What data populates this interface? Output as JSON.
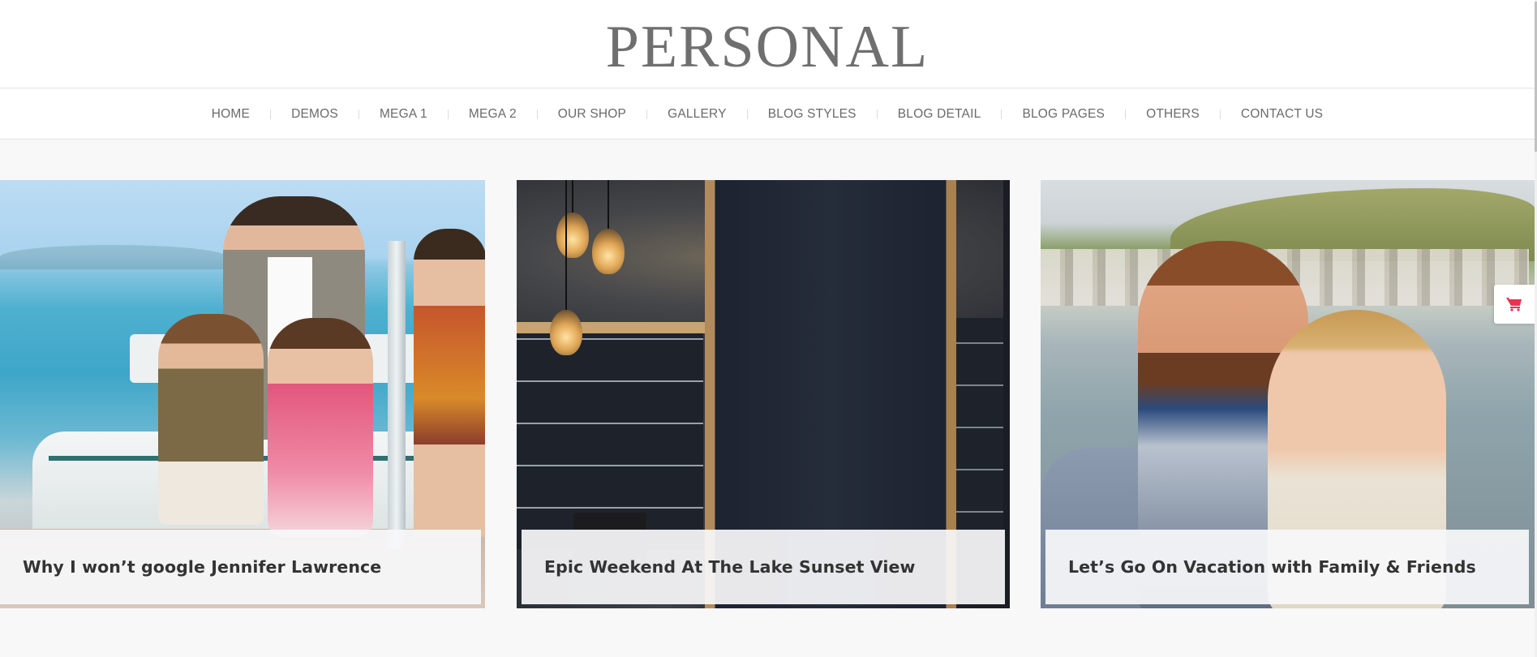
{
  "site": {
    "logo_text": "PERSONAL"
  },
  "nav": {
    "items": [
      {
        "label": "HOME"
      },
      {
        "label": "DEMOS"
      },
      {
        "label": "MEGA 1"
      },
      {
        "label": "MEGA 2"
      },
      {
        "label": "OUR SHOP"
      },
      {
        "label": "GALLERY"
      },
      {
        "label": "BLOG STYLES"
      },
      {
        "label": "BLOG DETAIL"
      },
      {
        "label": "BLOG PAGES"
      },
      {
        "label": "OTHERS"
      },
      {
        "label": "CONTACT US"
      }
    ]
  },
  "slider": {
    "cards": [
      {
        "title": "Why I won’t google Jennifer Lawrence",
        "image": "family-on-pier-photo"
      },
      {
        "title": "Epic Weekend At The Lake Sunset View",
        "image": "chalkboard-kitchen-photo"
      },
      {
        "title": "Let’s Go On Vacation with Family & Friends",
        "image": "couple-selfie-photo"
      }
    ]
  },
  "widgets": {
    "cart_icon": "shopping-cart-icon",
    "cart_color": "#e8334f"
  },
  "colors": {
    "logo": "#6f6f6f",
    "nav_text": "#6a6a6a",
    "page_bg": "#f8f8f8",
    "caption_text": "#333333"
  }
}
